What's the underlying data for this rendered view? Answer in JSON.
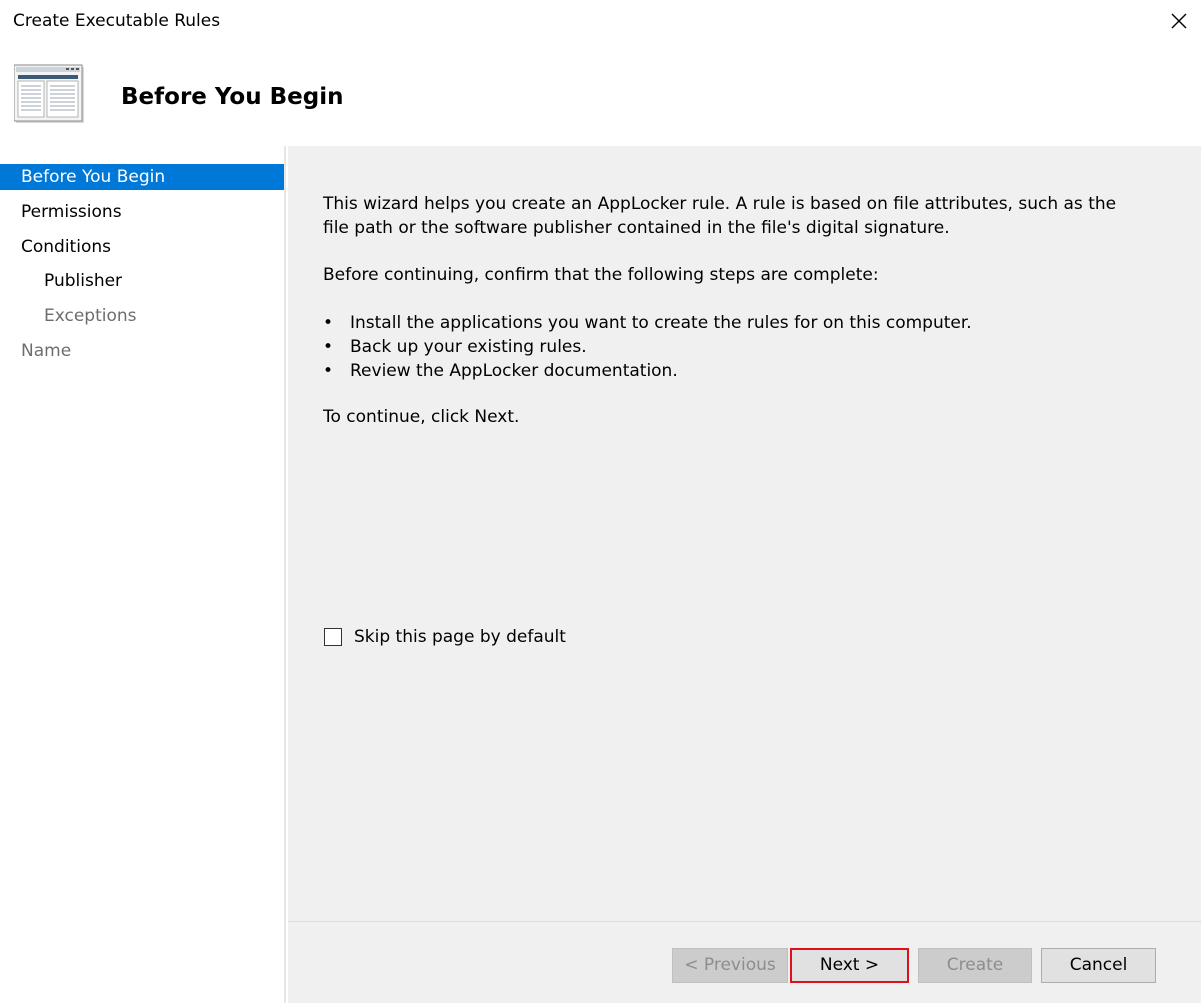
{
  "window": {
    "title": "Create Executable Rules",
    "close_icon": "close-icon"
  },
  "header": {
    "icon": "wizard-window-icon",
    "title": "Before You Begin"
  },
  "nav": {
    "items": [
      {
        "label": "Before You Begin",
        "state": "selected"
      },
      {
        "label": "Permissions",
        "state": "normal"
      },
      {
        "label": "Conditions",
        "state": "normal"
      },
      {
        "label": "Publisher",
        "state": "normal"
      },
      {
        "label": "Exceptions",
        "state": "disabled"
      },
      {
        "label": "Name",
        "state": "disabled"
      }
    ],
    "selected_color": "#0078d7"
  },
  "content": {
    "intro": "This wizard helps you create an AppLocker rule. A rule is based on file attributes, such as the file path or the software publisher contained in the file's digital signature.",
    "confirm": "Before continuing, confirm that the following steps are complete:",
    "steps": [
      "Install the applications you want to create the rules for on this computer.",
      "Back up your existing rules.",
      "Review the AppLocker documentation."
    ],
    "bullet": "•",
    "continue_text": "To continue, click Next.",
    "skip_label": "Skip this page by default",
    "skip_checked": false
  },
  "buttons": {
    "previous": "< Previous",
    "next": "Next >",
    "create": "Create",
    "cancel": "Cancel",
    "highlight_color": "#e0101a"
  }
}
